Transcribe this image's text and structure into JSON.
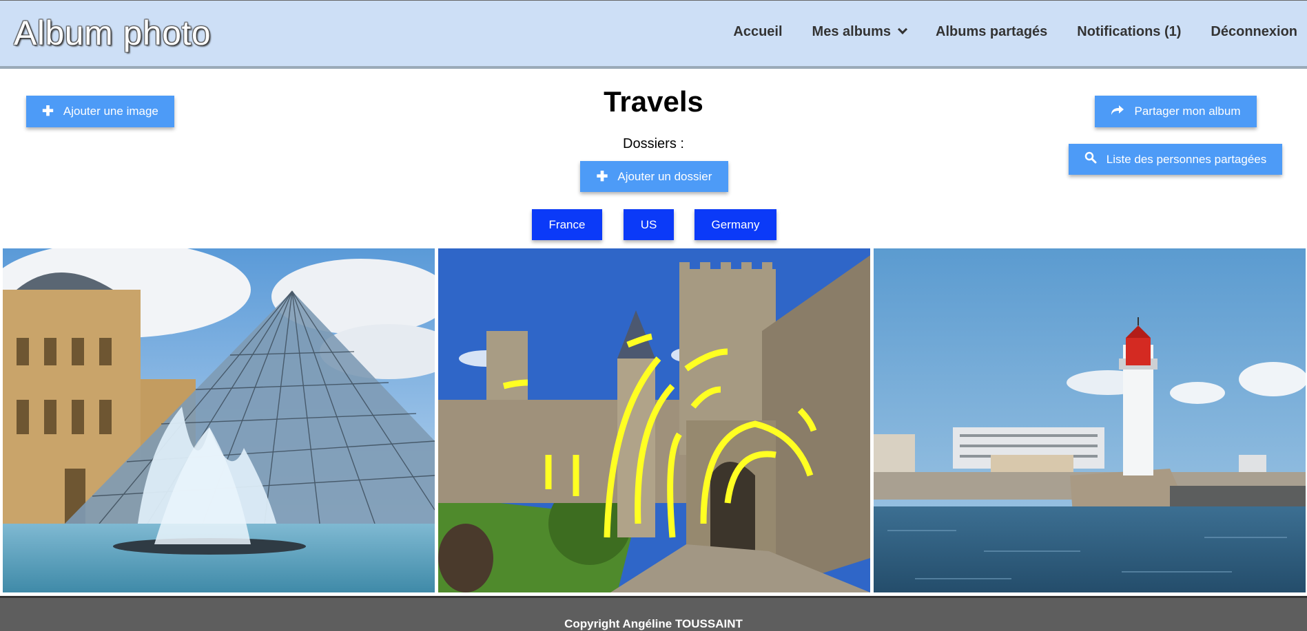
{
  "header": {
    "brand": "Album photo",
    "nav": {
      "home": "Accueil",
      "my_albums": "Mes albums",
      "shared_albums": "Albums partagés",
      "notifications": "Notifications (1)",
      "logout": "Déconnexion"
    }
  },
  "main": {
    "album_title": "Travels",
    "folders_label": "Dossiers :",
    "add_image": "Ajouter une image",
    "add_folder": "Ajouter un dossier",
    "share_album": "Partager mon album",
    "shared_people": "Liste des personnes partagées",
    "folders": [
      "France",
      "US",
      "Germany"
    ]
  },
  "footer": {
    "copyright": "Copyright Angéline TOUSSAINT"
  },
  "colors": {
    "header_bg": "#cddff6",
    "button_light": "#4d9bf7",
    "button_folder": "#0b3af8",
    "footer_bg": "#5e5e5e"
  }
}
